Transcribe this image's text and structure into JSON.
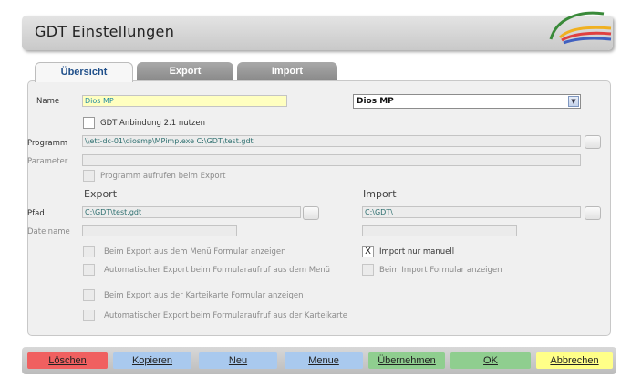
{
  "header": {
    "title": "GDT Einstellungen"
  },
  "tabs": [
    {
      "label": "Übersicht",
      "active": true
    },
    {
      "label": "Export",
      "active": false
    },
    {
      "label": "Import",
      "active": false
    }
  ],
  "form": {
    "name_label": "Name",
    "name_value": "Dios MP",
    "name_select": "Dios MP",
    "gdt21_label": "GDT Anbindung 2.1 nutzen",
    "programm_label": "Programm",
    "programm_value": "\\\\ett-dc-01\\diosmp\\MPimp.exe C:\\GDT\\test.gdt",
    "parameter_label": "Parameter",
    "parameter_value": "",
    "aufrufen_label": "Programm aufrufen beim Export",
    "export_heading": "Export",
    "import_heading": "Import",
    "pfad_label": "Pfad",
    "export_pfad": "C:\\GDT\\test.gdt",
    "import_pfad": "C:\\GDT\\",
    "dateiname_label": "Dateiname",
    "opt_menu_formular": "Beim Export aus dem Menü Formular anzeigen",
    "opt_auto_menu": "Automatischer Export  beim Formularaufruf aus dem Menü",
    "opt_kartei_formular": "Beim Export aus der Karteikarte Formular anzeigen",
    "opt_auto_kartei": "Automatischer Export beim Formularaufruf aus der Karteikarte",
    "import_manuell": "Import nur manuell",
    "import_manuell_mark": "X",
    "import_formular": "Beim Import Formular anzeigen"
  },
  "buttons": {
    "loeschen": "Löschen",
    "kopieren": "Kopieren",
    "neu": "Neu",
    "menue": "Menue",
    "uebernehmen": "Übernehmen",
    "ok": "OK",
    "abbrechen": "Abbrechen"
  },
  "colors": {
    "loeschen": "#f06060",
    "kopieren": "#a9c9ee",
    "neu": "#a9c9ee",
    "menue": "#a9c9ee",
    "uebernehmen": "#8fce8f",
    "ok": "#8fce8f",
    "abbrechen": "#ffff88"
  }
}
